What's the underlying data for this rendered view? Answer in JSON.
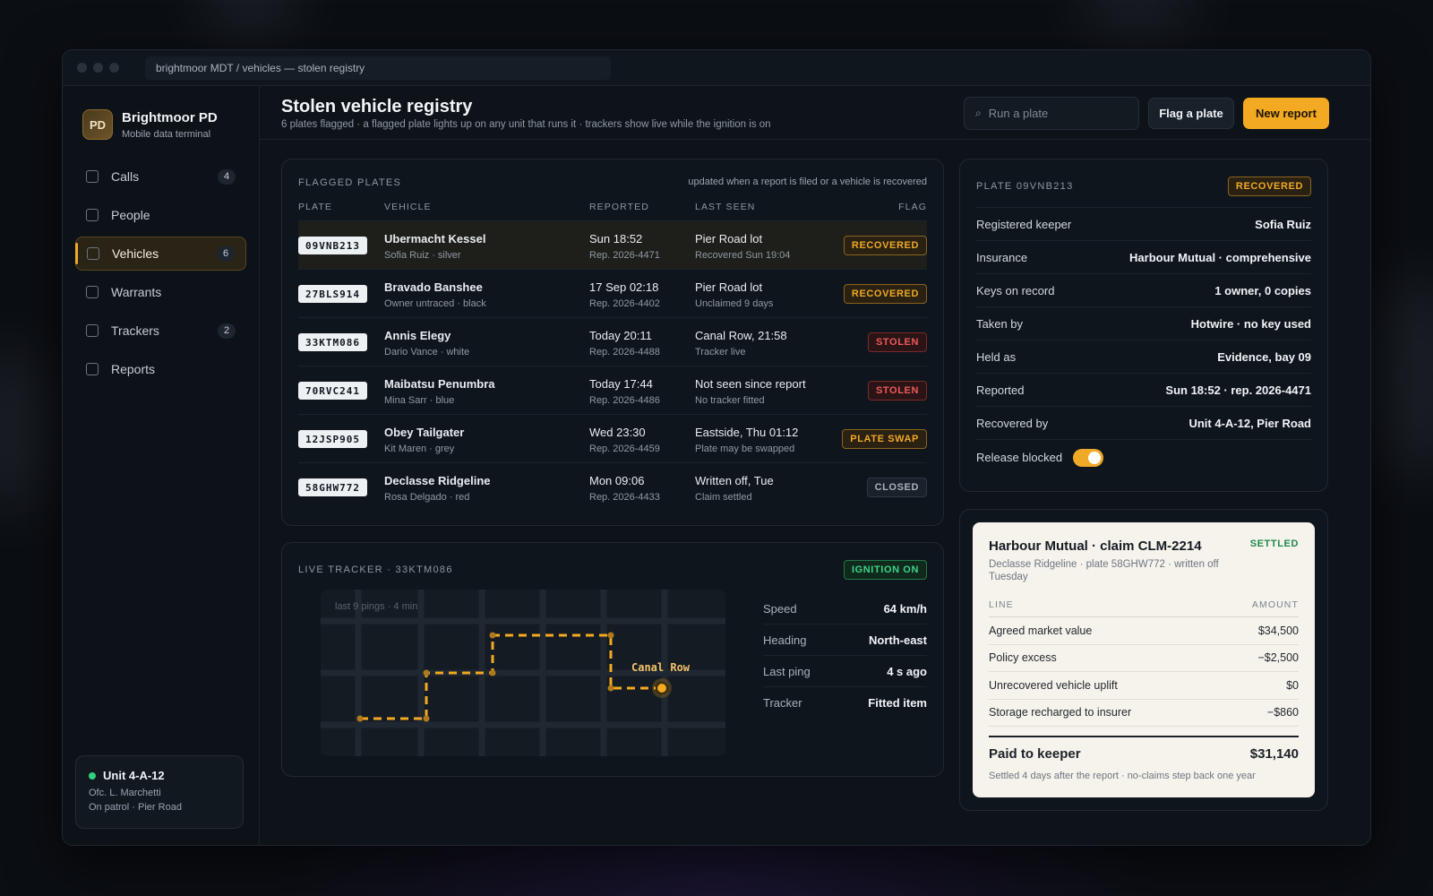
{
  "window": {
    "address": "brightmoor MDT / vehicles — stolen registry"
  },
  "brand": {
    "initials": "PD",
    "name": "Brightmoor PD",
    "subtitle": "Mobile data terminal"
  },
  "nav": [
    {
      "label": "Calls",
      "count": "4"
    },
    {
      "label": "People",
      "count": null
    },
    {
      "label": "Vehicles",
      "count": "6"
    },
    {
      "label": "Warrants",
      "count": null
    },
    {
      "label": "Trackers",
      "count": "2"
    },
    {
      "label": "Reports",
      "count": null
    }
  ],
  "unit": {
    "name": "Unit 4-A-12",
    "officer": "Ofc. L. Marchetti",
    "status": "On patrol · Pier Road"
  },
  "header": {
    "title": "Stolen vehicle registry",
    "subtitle": "6 plates flagged · a flagged plate lights up on any unit that runs it · trackers show live while the ignition is on",
    "search_placeholder": "Run a plate",
    "flag_label": "Flag a plate",
    "new_label": "New report"
  },
  "plates": {
    "label": "FLAGGED PLATES",
    "note": "updated when a report is filed or a vehicle is recovered",
    "columns": [
      "PLATE",
      "VEHICLE",
      "REPORTED",
      "LAST SEEN",
      "FLAG"
    ],
    "rows": [
      {
        "plate": "09VNB213",
        "vehicle": "Ubermacht Kessel",
        "owner": "Sofia Ruiz · silver",
        "reported": "Sun 18:52",
        "rep_no": "Rep. 2026-4471",
        "seen": "Pier Road lot",
        "seen_note": "Recovered Sun 19:04",
        "flag": "RECOVERED"
      },
      {
        "plate": "27BLS914",
        "vehicle": "Bravado Banshee",
        "owner": "Owner untraced · black",
        "reported": "17 Sep 02:18",
        "rep_no": "Rep. 2026-4402",
        "seen": "Pier Road lot",
        "seen_note": "Unclaimed 9 days",
        "flag": "RECOVERED"
      },
      {
        "plate": "33KTM086",
        "vehicle": "Annis Elegy",
        "owner": "Dario Vance · white",
        "reported": "Today 20:11",
        "rep_no": "Rep. 2026-4488",
        "seen": "Canal Row, 21:58",
        "seen_note": "Tracker live",
        "flag": "STOLEN"
      },
      {
        "plate": "70RVC241",
        "vehicle": "Maibatsu Penumbra",
        "owner": "Mina Sarr · blue",
        "reported": "Today 17:44",
        "rep_no": "Rep. 2026-4486",
        "seen": "Not seen since report",
        "seen_note": "No tracker fitted",
        "flag": "STOLEN"
      },
      {
        "plate": "12JSP905",
        "vehicle": "Obey Tailgater",
        "owner": "Kit Maren · grey",
        "reported": "Wed 23:30",
        "rep_no": "Rep. 2026-4459",
        "seen": "Eastside, Thu 01:12",
        "seen_note": "Plate may be swapped",
        "flag": "PLATE SWAP"
      },
      {
        "plate": "58GHW772",
        "vehicle": "Declasse Ridgeline",
        "owner": "Rosa Delgado · red",
        "reported": "Mon 09:06",
        "rep_no": "Rep. 2026-4433",
        "seen": "Written off, Tue",
        "seen_note": "Claim settled",
        "flag": "CLOSED"
      }
    ]
  },
  "tracker": {
    "label": "LIVE TRACKER · 33KTM086",
    "badge": "IGNITION ON",
    "map_caption": "last 9 pings · 4 min",
    "location_label": "Canal Row",
    "stats": [
      {
        "key": "Speed",
        "value": "64 km/h"
      },
      {
        "key": "Heading",
        "value": "North-east"
      },
      {
        "key": "Last ping",
        "value": "4 s ago"
      },
      {
        "key": "Tracker",
        "value": "Fitted item"
      }
    ]
  },
  "detail": {
    "label": "PLATE 09VNB213",
    "badge": "RECOVERED",
    "rows": [
      {
        "key": "Registered keeper",
        "value": "Sofia Ruiz"
      },
      {
        "key": "Insurance",
        "value": "Harbour Mutual · comprehensive"
      },
      {
        "key": "Keys on record",
        "value": "1 owner, 0 copies"
      },
      {
        "key": "Taken by",
        "value": "Hotwire · no key used"
      },
      {
        "key": "Held as",
        "value": "Evidence, bay 09"
      },
      {
        "key": "Reported",
        "value": "Sun 18:52 · rep. 2026-4471"
      },
      {
        "key": "Recovered by",
        "value": "Unit 4-A-12, Pier Road"
      }
    ],
    "release_label": "Release blocked",
    "release_on": true
  },
  "claim": {
    "title": "Harbour Mutual · claim CLM-2214",
    "status": "SETTLED",
    "subtitle": "Declasse Ridgeline · plate 58GHW772 · written off Tuesday",
    "col_line": "LINE",
    "col_amount": "AMOUNT",
    "lines": [
      {
        "label": "Agreed market value",
        "amount": "$34,500"
      },
      {
        "label": "Policy excess",
        "amount": "−$2,500"
      },
      {
        "label": "Unrecovered vehicle uplift",
        "amount": "$0"
      },
      {
        "label": "Storage recharged to insurer",
        "amount": "−$860"
      }
    ],
    "total_label": "Paid to keeper",
    "total_amount": "$31,140",
    "footnote": "Settled 4 days after the report · no-claims step back one year"
  },
  "colors": {
    "accent": "#f3a921",
    "stolen": "#ef5a5a",
    "live": "#3fd48a"
  }
}
